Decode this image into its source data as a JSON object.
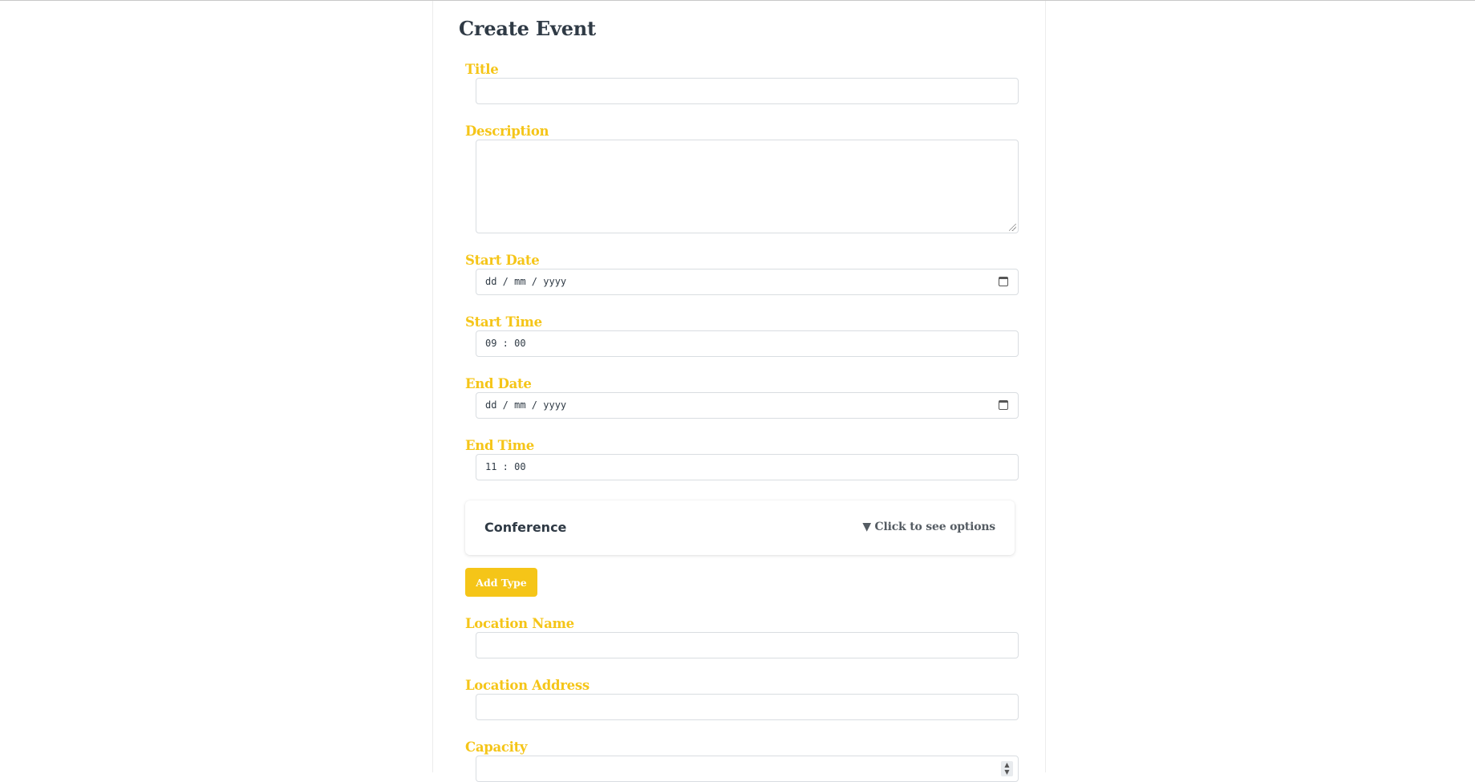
{
  "page": {
    "title": "Create Event"
  },
  "form": {
    "title_label": "Title",
    "title_value": "",
    "description_label": "Description",
    "description_value": "",
    "start_date_label": "Start Date",
    "start_date_value": "dd / mm / yyyy",
    "start_time_label": "Start Time",
    "start_time_value": "09 : 00",
    "end_date_label": "End Date",
    "end_date_value": "dd / mm / yyyy",
    "end_time_label": "End Time",
    "end_time_value": "11 : 00",
    "event_type": {
      "name": "Conference",
      "toggle_label": "▼ Click to see options"
    },
    "add_type_label": "Add Type",
    "location_name_label": "Location Name",
    "location_name_value": "",
    "location_address_label": "Location Address",
    "location_address_value": "",
    "capacity_label": "Capacity",
    "capacity_value": ""
  },
  "icons": {
    "date_picker": "calendar-icon",
    "number_spinner": "spinner-arrows-icon",
    "textarea_resize": "resize-grip-icon"
  },
  "colors": {
    "accent": "#f5c518",
    "heading": "#2f3a45",
    "border": "#d9dde1"
  }
}
